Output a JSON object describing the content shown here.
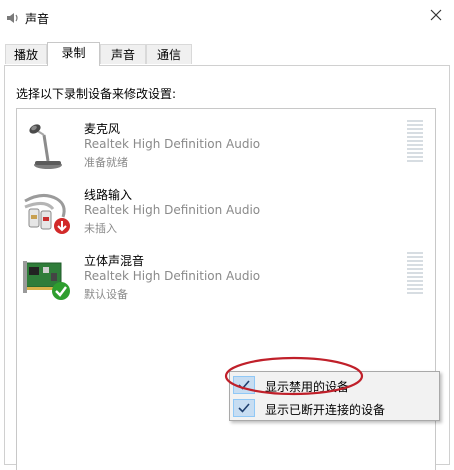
{
  "window": {
    "title": "声音",
    "icon": "speaker-icon"
  },
  "tabs": [
    {
      "label": "播放",
      "active": false
    },
    {
      "label": "录制",
      "active": true
    },
    {
      "label": "声音",
      "active": false
    },
    {
      "label": "通信",
      "active": false
    }
  ],
  "instruction": "选择以下录制设备来修改设置:",
  "devices": [
    {
      "name": "麦克风",
      "driver": "Realtek High Definition Audio",
      "status": "准备就绪",
      "icon": "microphone-icon",
      "badge": null
    },
    {
      "name": "线路输入",
      "driver": "Realtek High Definition Audio",
      "status": "未插入",
      "icon": "line-in-cable-icon",
      "badge": "unplugged-arrow-icon"
    },
    {
      "name": "立体声混音",
      "driver": "Realtek High Definition Audio",
      "status": "默认设备",
      "icon": "sound-card-icon",
      "badge": "default-check-icon"
    }
  ],
  "context_menu": {
    "items": [
      {
        "label": "显示禁用的设备",
        "checked": true
      },
      {
        "label": "显示已断开连接的设备",
        "checked": true
      }
    ]
  },
  "colors": {
    "highlight_ellipse": "#c0202a",
    "check_blue": "#2a6fc9",
    "default_green": "#2e9e2e",
    "unplugged_red": "#d22a2a"
  }
}
